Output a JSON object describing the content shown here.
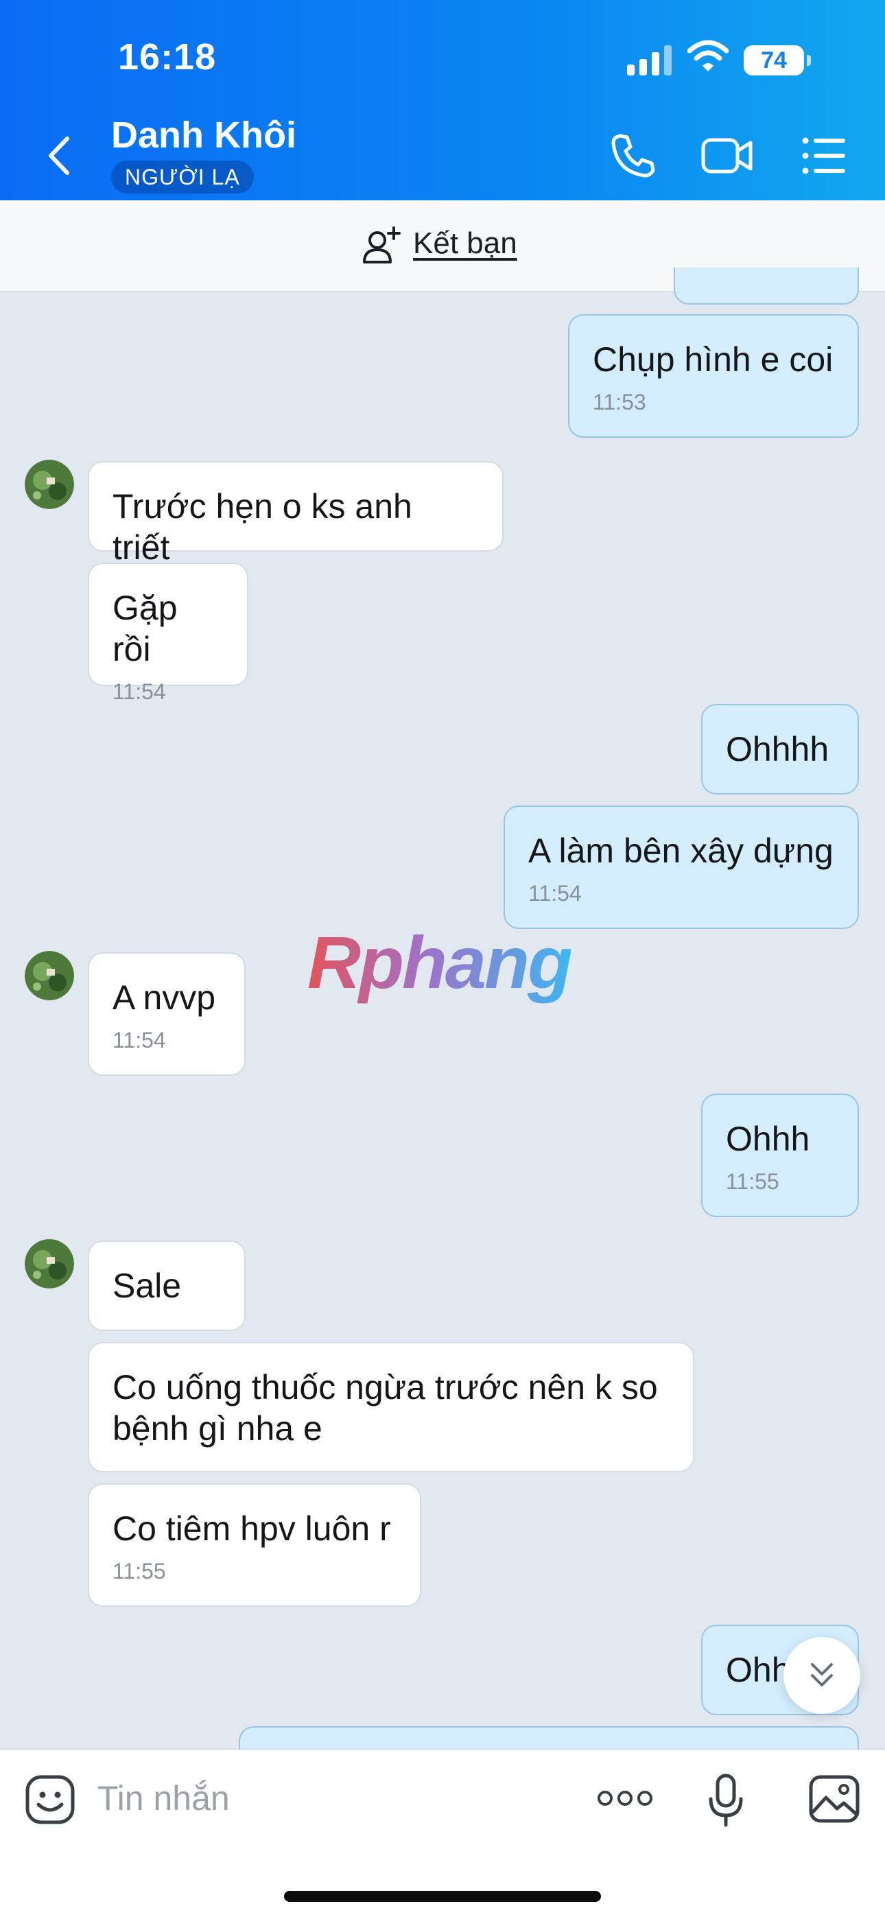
{
  "status_bar": {
    "time": "16:18",
    "battery": "74"
  },
  "header": {
    "contact_name": "Danh Khôi",
    "badge": "NGƯỜI LẠ"
  },
  "friend_bar": {
    "label": "Kết bạn"
  },
  "messages": [
    {
      "from": "me",
      "text": "Chụp hình e coi",
      "time": "11:53"
    },
    {
      "from": "them",
      "text": "Trước hẹn o ks anh triết",
      "time": ""
    },
    {
      "from": "them",
      "text": "Gặp rồi",
      "time": "11:54"
    },
    {
      "from": "me",
      "text": "Ohhhh",
      "time": ""
    },
    {
      "from": "me",
      "text": "A làm bên xây dựng",
      "time": "11:54"
    },
    {
      "from": "them",
      "text": "A nvvp",
      "time": "11:54"
    },
    {
      "from": "me",
      "text": "Ohhh",
      "time": "11:55"
    },
    {
      "from": "them",
      "text": "Sale",
      "time": ""
    },
    {
      "from": "them",
      "text": "Co uống thuốc ngừa trước nên k so bệnh gì nha e",
      "time": ""
    },
    {
      "from": "them",
      "text": "Co tiêm hpv luôn r",
      "time": "11:55"
    },
    {
      "from": "me",
      "text": "Ohh",
      "time": ""
    }
  ],
  "watermark": "Rphang",
  "composer": {
    "placeholder": "Tin nhắn"
  },
  "icons": {
    "header": [
      "back-icon",
      "phone-icon",
      "video-call-icon",
      "menu-list-icon"
    ],
    "composer": [
      "emoji-icon",
      "more-icon",
      "microphone-icon",
      "image-icon"
    ],
    "scroll": "chevron-double-down-icon"
  },
  "colors": {
    "header_start": "#0a6cf4",
    "header_end": "#12a7ef",
    "outgoing_bubble": "#d3edfd",
    "incoming_bubble": "#ffffff",
    "chat_background": "#e2e8f0"
  }
}
